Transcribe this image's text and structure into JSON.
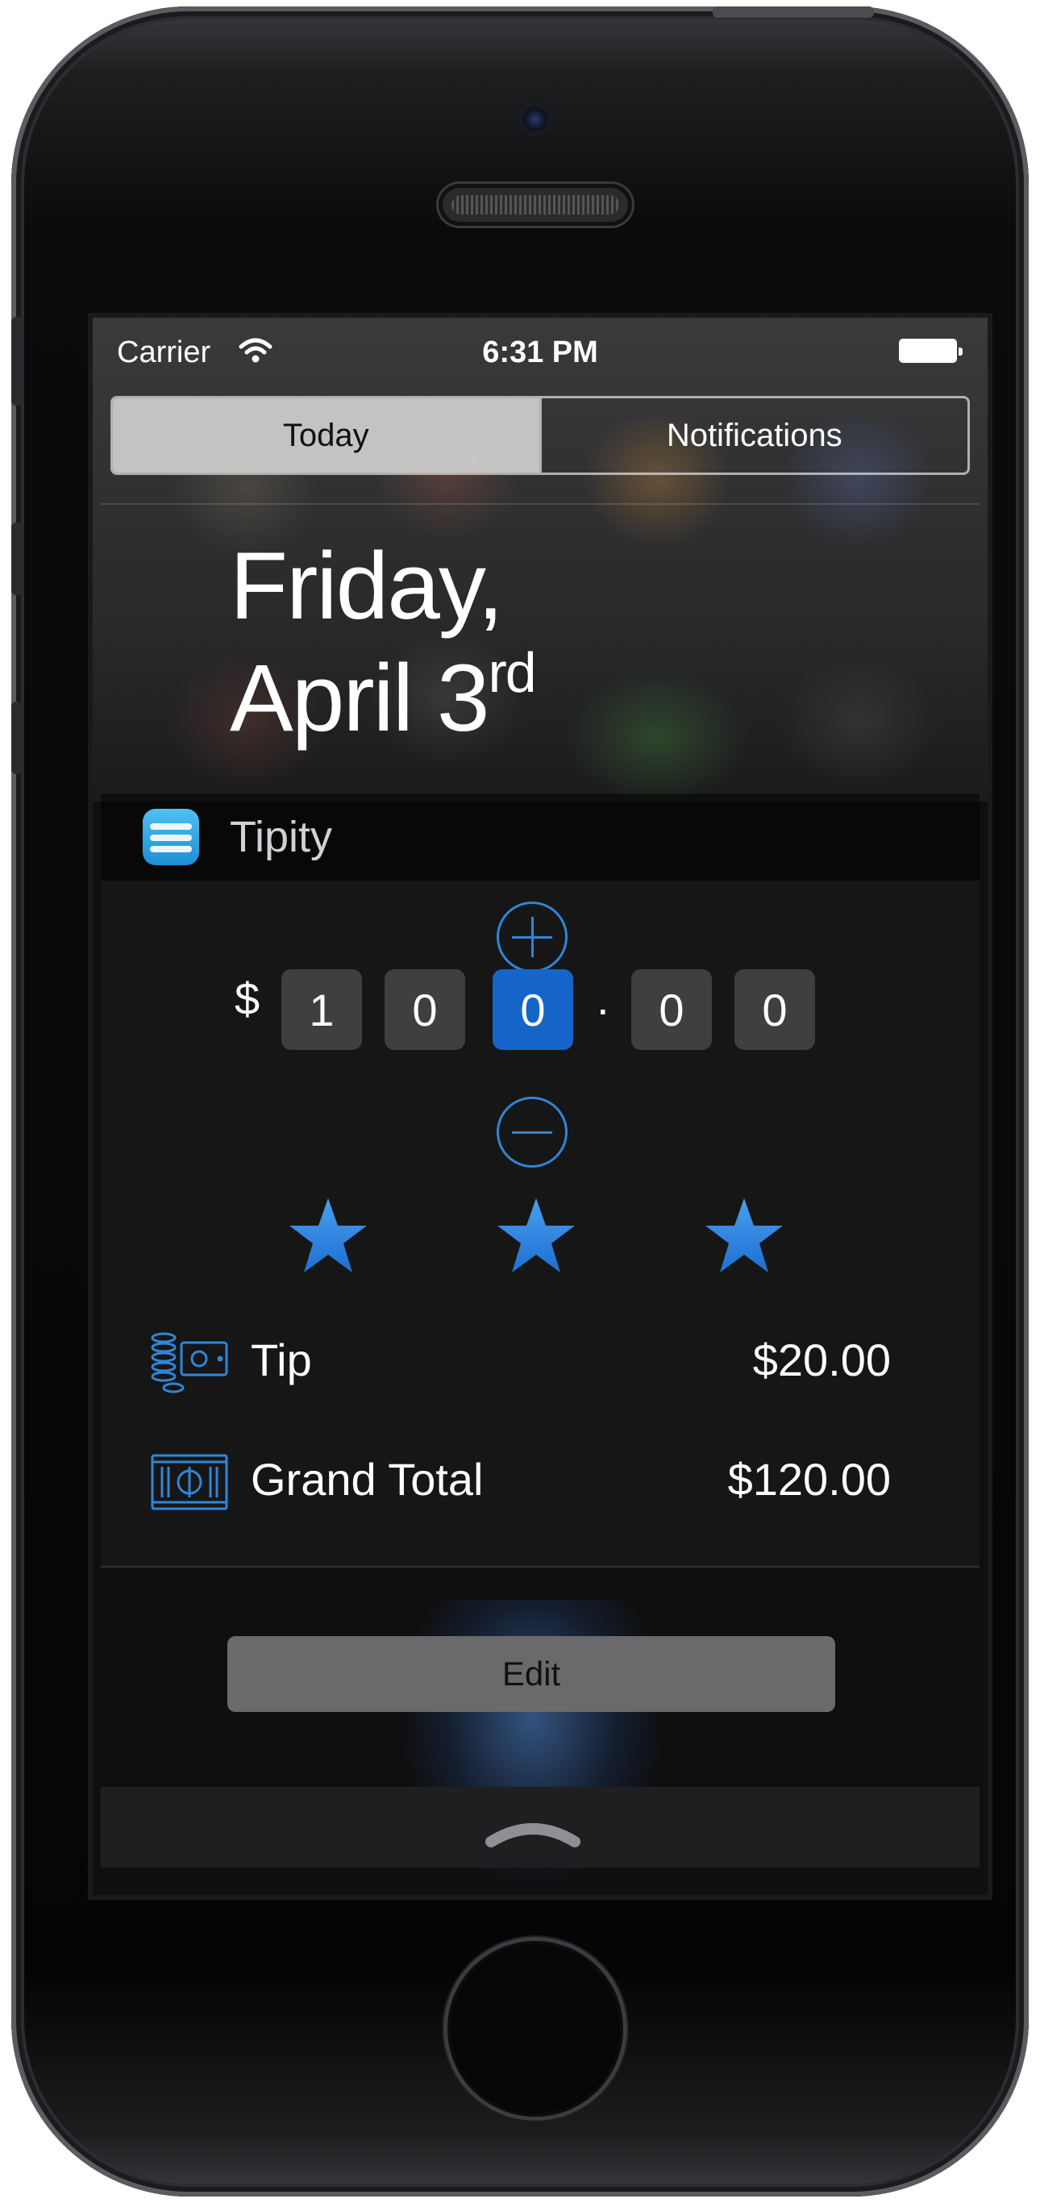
{
  "status_bar": {
    "carrier": "Carrier",
    "time": "6:31 PM"
  },
  "segments": {
    "today": "Today",
    "notifications": "Notifications",
    "selected": "Today"
  },
  "date": {
    "line1": "Friday,",
    "line2": "April 3",
    "line2_suffix": "rd"
  },
  "widget": {
    "title": "Tipity",
    "icon": "tipity-app-icon",
    "amount": {
      "currency": "$",
      "digits": [
        "1",
        "0",
        "0",
        "0",
        "0"
      ],
      "decimal": ".",
      "active_digit_index": 2
    },
    "rating": {
      "stars": 3,
      "max": 3
    },
    "tip": {
      "label": "Tip",
      "value": "$20.00",
      "icon": "coins-cash-icon"
    },
    "grand_total": {
      "label": "Grand Total",
      "value": "$120.00",
      "icon": "banknote-stack-icon"
    }
  },
  "edit_button": {
    "label": "Edit"
  },
  "colors": {
    "accent": "#2f86d6",
    "active_digit": "#1565c8",
    "digit_bg": "#3f3f41"
  }
}
